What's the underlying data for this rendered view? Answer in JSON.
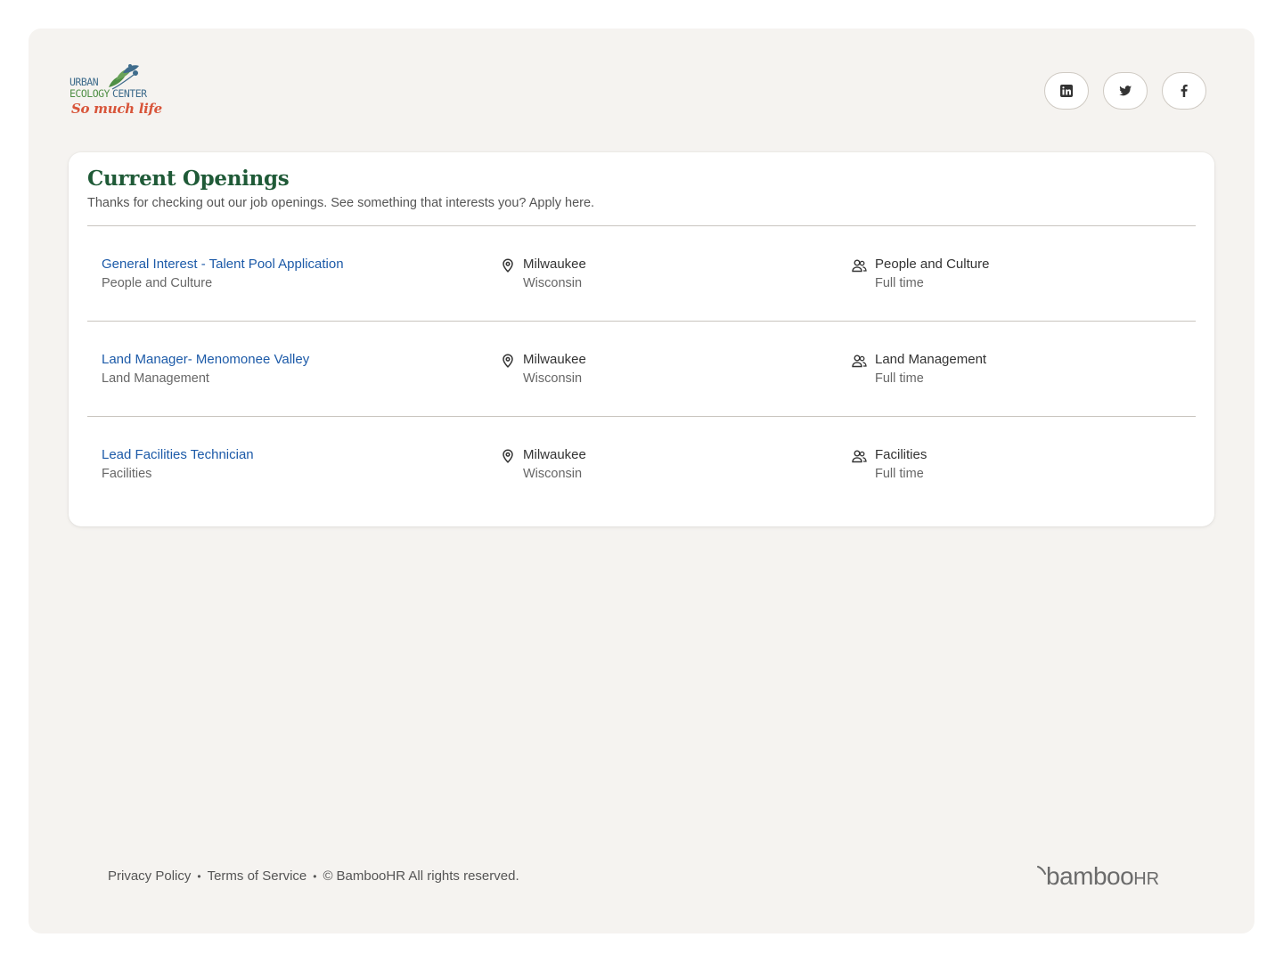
{
  "brand": {
    "logo_line1": "URBAN",
    "logo_line2a": "ECOLOGY",
    "logo_line2b": "CENTER",
    "tagline": "So much life",
    "colors": {
      "blue": "#3f6c8c",
      "green": "#4f8f45",
      "orange": "#d8553a"
    }
  },
  "socials": [
    {
      "name": "linkedin",
      "icon": "linkedin-icon"
    },
    {
      "name": "twitter",
      "icon": "twitter-icon"
    },
    {
      "name": "facebook",
      "icon": "facebook-icon"
    }
  ],
  "openings": {
    "title": "Current Openings",
    "subtitle": "Thanks for checking out our job openings. See something that interests you? Apply here.",
    "jobs": [
      {
        "title": "General Interest - Talent Pool Application",
        "department": "People and Culture",
        "city": "Milwaukee",
        "state": "Wisconsin",
        "team": "People and Culture",
        "type": "Full time"
      },
      {
        "title": "Land Manager- Menomonee Valley",
        "department": "Land Management",
        "city": "Milwaukee",
        "state": "Wisconsin",
        "team": "Land Management",
        "type": "Full time"
      },
      {
        "title": "Lead Facilities Technician",
        "department": "Facilities",
        "city": "Milwaukee",
        "state": "Wisconsin",
        "team": "Facilities",
        "type": "Full time"
      }
    ]
  },
  "footer": {
    "privacy": "Privacy Policy",
    "terms": "Terms of Service",
    "copyright_symbol": "©",
    "copyright": "BambooHR All rights reserved.",
    "powered_by_word": "bamboo",
    "powered_by_suffix": "HR"
  },
  "theme": {
    "title_green": "#1f5a37",
    "link_blue": "#1c5aa8",
    "background": "#f5f3f0"
  }
}
